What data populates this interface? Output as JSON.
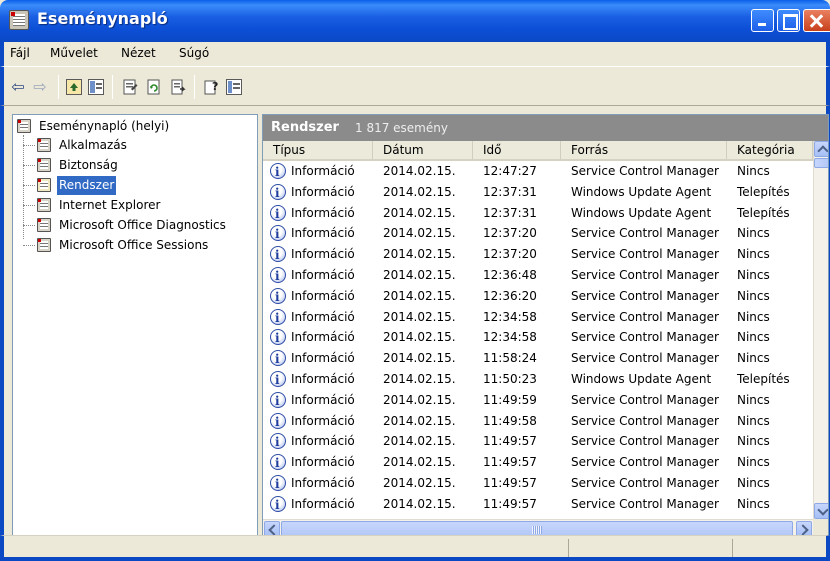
{
  "window": {
    "title": "Eseménynapló"
  },
  "menu": [
    {
      "label": "Fájl"
    },
    {
      "label": "Művelet"
    },
    {
      "label": "Nézet"
    },
    {
      "label": "Súgó"
    }
  ],
  "tree": {
    "root": "Eseménynapló (helyi)",
    "children": [
      {
        "label": "Alkalmazás",
        "selected": false
      },
      {
        "label": "Biztonság",
        "selected": false
      },
      {
        "label": "Rendszer",
        "selected": true
      },
      {
        "label": "Internet Explorer",
        "selected": false
      },
      {
        "label": "Microsoft Office Diagnostics",
        "selected": false
      },
      {
        "label": "Microsoft Office Sessions",
        "selected": false
      }
    ]
  },
  "list": {
    "title": "Rendszer",
    "count": "1 817 esemény",
    "columns": [
      "Típus",
      "Dátum",
      "Idő",
      "Forrás",
      "Kategória"
    ],
    "rows": [
      [
        "Információ",
        "2014.02.15.",
        "12:47:27",
        "Service Control Manager",
        "Nincs"
      ],
      [
        "Információ",
        "2014.02.15.",
        "12:37:31",
        "Windows Update Agent",
        "Telepítés"
      ],
      [
        "Információ",
        "2014.02.15.",
        "12:37:31",
        "Windows Update Agent",
        "Telepítés"
      ],
      [
        "Információ",
        "2014.02.15.",
        "12:37:20",
        "Service Control Manager",
        "Nincs"
      ],
      [
        "Információ",
        "2014.02.15.",
        "12:37:20",
        "Service Control Manager",
        "Nincs"
      ],
      [
        "Információ",
        "2014.02.15.",
        "12:36:48",
        "Service Control Manager",
        "Nincs"
      ],
      [
        "Információ",
        "2014.02.15.",
        "12:36:20",
        "Service Control Manager",
        "Nincs"
      ],
      [
        "Információ",
        "2014.02.15.",
        "12:34:58",
        "Service Control Manager",
        "Nincs"
      ],
      [
        "Információ",
        "2014.02.15.",
        "12:34:58",
        "Service Control Manager",
        "Nincs"
      ],
      [
        "Információ",
        "2014.02.15.",
        "11:58:24",
        "Service Control Manager",
        "Nincs"
      ],
      [
        "Információ",
        "2014.02.15.",
        "11:50:23",
        "Windows Update Agent",
        "Telepítés"
      ],
      [
        "Információ",
        "2014.02.15.",
        "11:49:59",
        "Service Control Manager",
        "Nincs"
      ],
      [
        "Információ",
        "2014.02.15.",
        "11:49:58",
        "Service Control Manager",
        "Nincs"
      ],
      [
        "Információ",
        "2014.02.15.",
        "11:49:57",
        "Service Control Manager",
        "Nincs"
      ],
      [
        "Információ",
        "2014.02.15.",
        "11:49:57",
        "Service Control Manager",
        "Nincs"
      ],
      [
        "Információ",
        "2014.02.15.",
        "11:49:57",
        "Service Control Manager",
        "Nincs"
      ],
      [
        "Információ",
        "2014.02.15.",
        "11:49:57",
        "Service Control Manager",
        "Nincs"
      ]
    ]
  },
  "icons": {
    "back": "back-arrow-icon",
    "forward": "forward-arrow-icon",
    "up": "up-folder-icon",
    "show_tree": "show-tree-icon",
    "properties": "properties-icon",
    "refresh": "refresh-icon",
    "export": "export-list-icon",
    "help": "help-icon",
    "view": "view-icon",
    "info": "info-icon"
  },
  "colors": {
    "titlebar": "#0b48c4",
    "selection": "#316ac5",
    "panel_header": "#8b8b8b"
  }
}
